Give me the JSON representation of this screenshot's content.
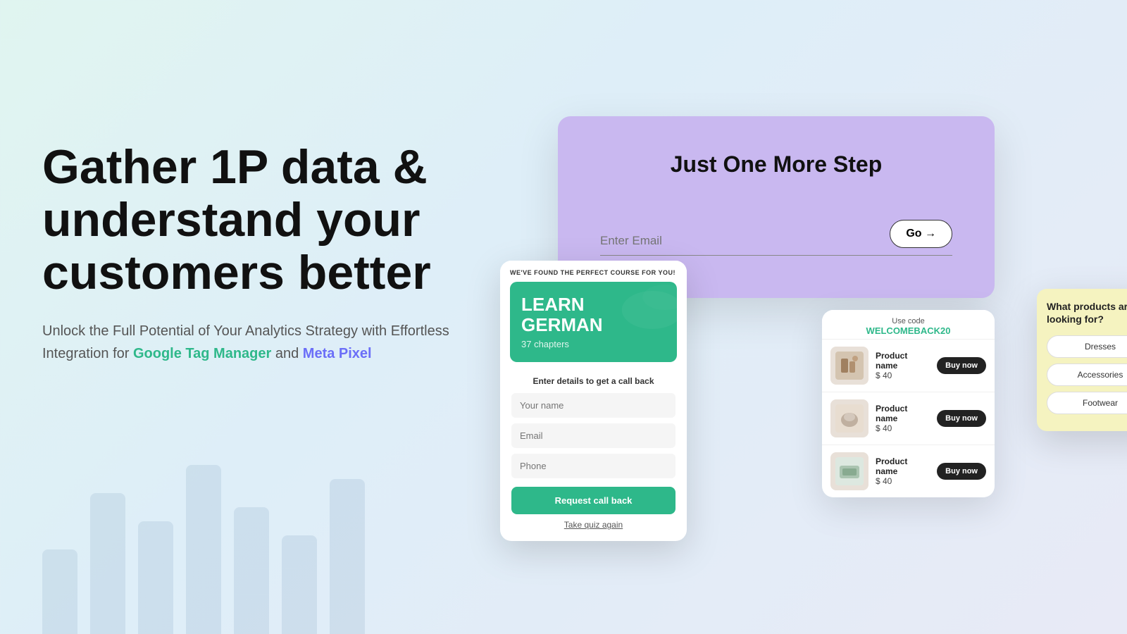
{
  "left": {
    "heading": "Gather 1P data & understand your customers better",
    "sub_text_start": "Unlock the Full Potential of Your Analytics Strategy with Effortless Integration for ",
    "link_gtm": "Google Tag Manager",
    "sub_text_mid": " and ",
    "link_meta": "Meta Pixel"
  },
  "purple_card": {
    "title": "Just One More Step",
    "email_placeholder": "Enter Email",
    "go_label": "Go →"
  },
  "course_card": {
    "found_label": "WE'VE FOUND THE PERFECT COURSE FOR YOU!",
    "course_title": "LEARN GERMAN",
    "course_sub": "37 chapters",
    "callback_label": "Enter details to get a call back",
    "name_placeholder": "Your name",
    "email_placeholder": "Email",
    "phone_placeholder": "Phone",
    "request_btn": "Request call back",
    "quiz_link": "Take quiz again"
  },
  "promo": {
    "use_code": "Use code",
    "code": "WELCOMEBACK20"
  },
  "products": [
    {
      "name": "Product name",
      "price": "$ 40",
      "buy": "Buy now"
    },
    {
      "name": "Product name",
      "price": "$ 40",
      "buy": "Buy now"
    },
    {
      "name": "Product name",
      "price": "$ 40",
      "buy": "Buy now"
    }
  ],
  "quiz": {
    "title": "What products are you looking for?",
    "options": [
      "Dresses",
      "Accessories",
      "Footwear"
    ]
  },
  "deco_bars": [
    120,
    200,
    160,
    240,
    180,
    140,
    220
  ]
}
